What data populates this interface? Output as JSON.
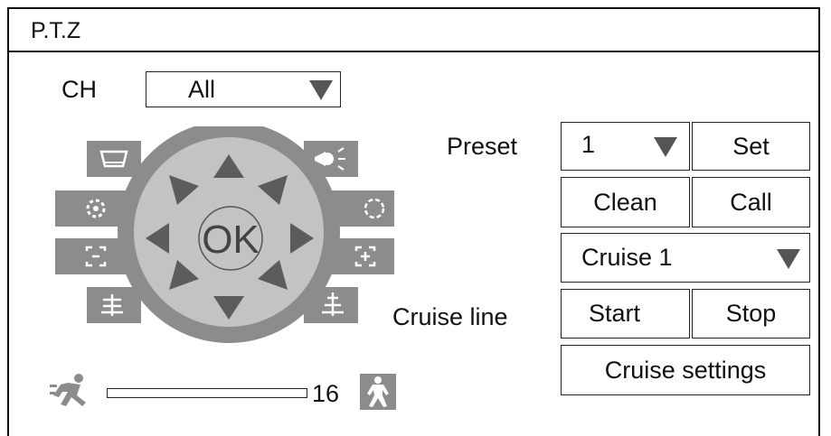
{
  "window": {
    "title": "P.T.Z"
  },
  "channel": {
    "label": "CH",
    "value": "All"
  },
  "dpad": {
    "center_label": "OK"
  },
  "preset": {
    "label": "Preset",
    "value": "1",
    "set_label": "Set",
    "clean_label": "Clean",
    "call_label": "Call"
  },
  "cruise": {
    "selected": "Cruise 1",
    "line_label": "Cruise line",
    "start_label": "Start",
    "stop_label": "Stop",
    "settings_label": "Cruise settings"
  },
  "speed": {
    "value": "16"
  },
  "colors": {
    "side_button": "#8c8c8c",
    "ring": "#8c8c8c",
    "inner": "#c3c3c3",
    "arrow": "#5c5c5c"
  },
  "icons": {
    "left_side": [
      "wiper-icon",
      "iris-close-icon",
      "zoom-out-icon",
      "focus-near-icon"
    ],
    "right_side": [
      "light-icon",
      "iris-open-icon",
      "zoom-in-icon",
      "focus-far-icon"
    ],
    "speed_slow": "running-person-icon",
    "speed_fast": "walking-person-icon"
  }
}
